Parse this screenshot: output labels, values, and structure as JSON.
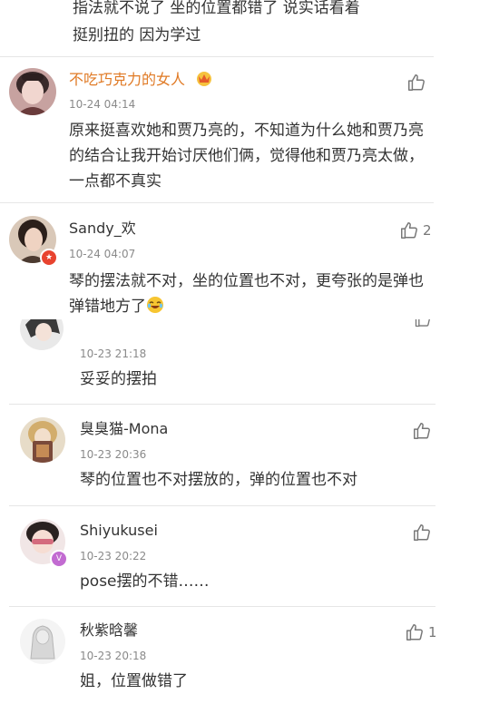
{
  "top_partial": {
    "line1": "指法就不说了 坐的位置都错了 说实话看着",
    "line2": "挺别扭的 因为学过"
  },
  "comments": [
    {
      "username": "不吃巧克力的女人",
      "timestamp": "10-24 04:14",
      "text": "原来挺喜欢她和贾乃亮的，不知道为什么她和贾乃亮的结合让我开始讨厌他们俩，觉得他和贾乃亮太做，一点都不真实",
      "like_count": ""
    },
    {
      "username": "Sandy_欢",
      "timestamp": "10-24 04:07",
      "text": "琴的摆法就不对，坐的位置也不对，更夸张的是弹也弹错地方了",
      "like_count": "2"
    },
    {
      "username": "",
      "timestamp": "10-23 21:18",
      "text": "妥妥的摆拍",
      "like_count": ""
    },
    {
      "username": "臭臭猫-Mona",
      "timestamp": "10-23 20:36",
      "text": "琴的位置也不对摆放的，弹的位置也不对",
      "like_count": ""
    },
    {
      "username": "Shiyukusei",
      "timestamp": "10-23 20:22",
      "text": "pose摆的不错……",
      "like_count": ""
    },
    {
      "username": "秋紫晗馨",
      "timestamp": "10-23 20:18",
      "text": "姐，位置做错了",
      "like_count": "1"
    }
  ],
  "colors": {
    "username_vip": "#e07a25",
    "username": "#333333",
    "timestamp": "#8a8a8a",
    "divider": "#e6e6e6",
    "accent_bar": "#f09b3a"
  },
  "icons": [
    "thumbs-up-icon",
    "vip-crown-icon",
    "laughing-emoji-icon",
    "verified-badge-icon"
  ]
}
